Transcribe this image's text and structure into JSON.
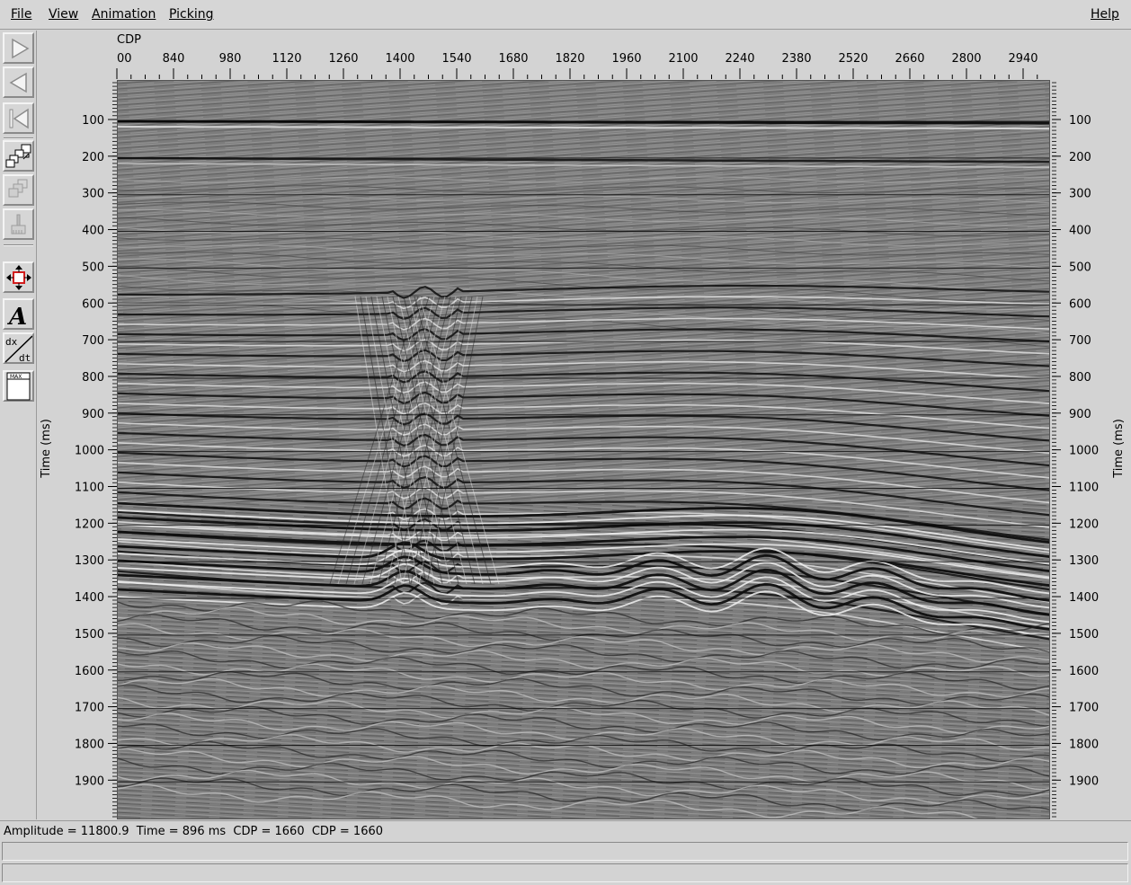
{
  "menu": {
    "file": "File",
    "view": "View",
    "animation": "Animation",
    "picking": "Picking",
    "help": "Help"
  },
  "toolbar_icons": [
    "play-forward-icon",
    "play-backward-icon",
    "rewind-to-start-icon",
    "window-swap-icon",
    "window-stack-icon",
    "brush-icon",
    "move-arrows-icon",
    "text-annotation-icon",
    "velocity-dx-dt-icon",
    "max-gain-icon"
  ],
  "top_axis": {
    "label": "CDP",
    "ticks": [
      "00",
      "840",
      "980",
      "1120",
      "1260",
      "1400",
      "1540",
      "1680",
      "1820",
      "1960",
      "2100",
      "2240",
      "2380",
      "2520",
      "2660",
      "2800",
      "2940"
    ]
  },
  "time_axis": {
    "label": "Time (ms)",
    "ticks": [
      "100",
      "200",
      "300",
      "400",
      "500",
      "600",
      "700",
      "800",
      "900",
      "1000",
      "1100",
      "1200",
      "1300",
      "1400",
      "1500",
      "1600",
      "1700",
      "1800",
      "1900"
    ]
  },
  "status": {
    "text": "Amplitude = 11800.9  Time = 896 ms  CDP = 1660  CDP = 1660"
  },
  "colors": {
    "background": "#d3d3d3",
    "seismic_mid": "#7c7c7c",
    "accent_red": "#d21e1e"
  }
}
